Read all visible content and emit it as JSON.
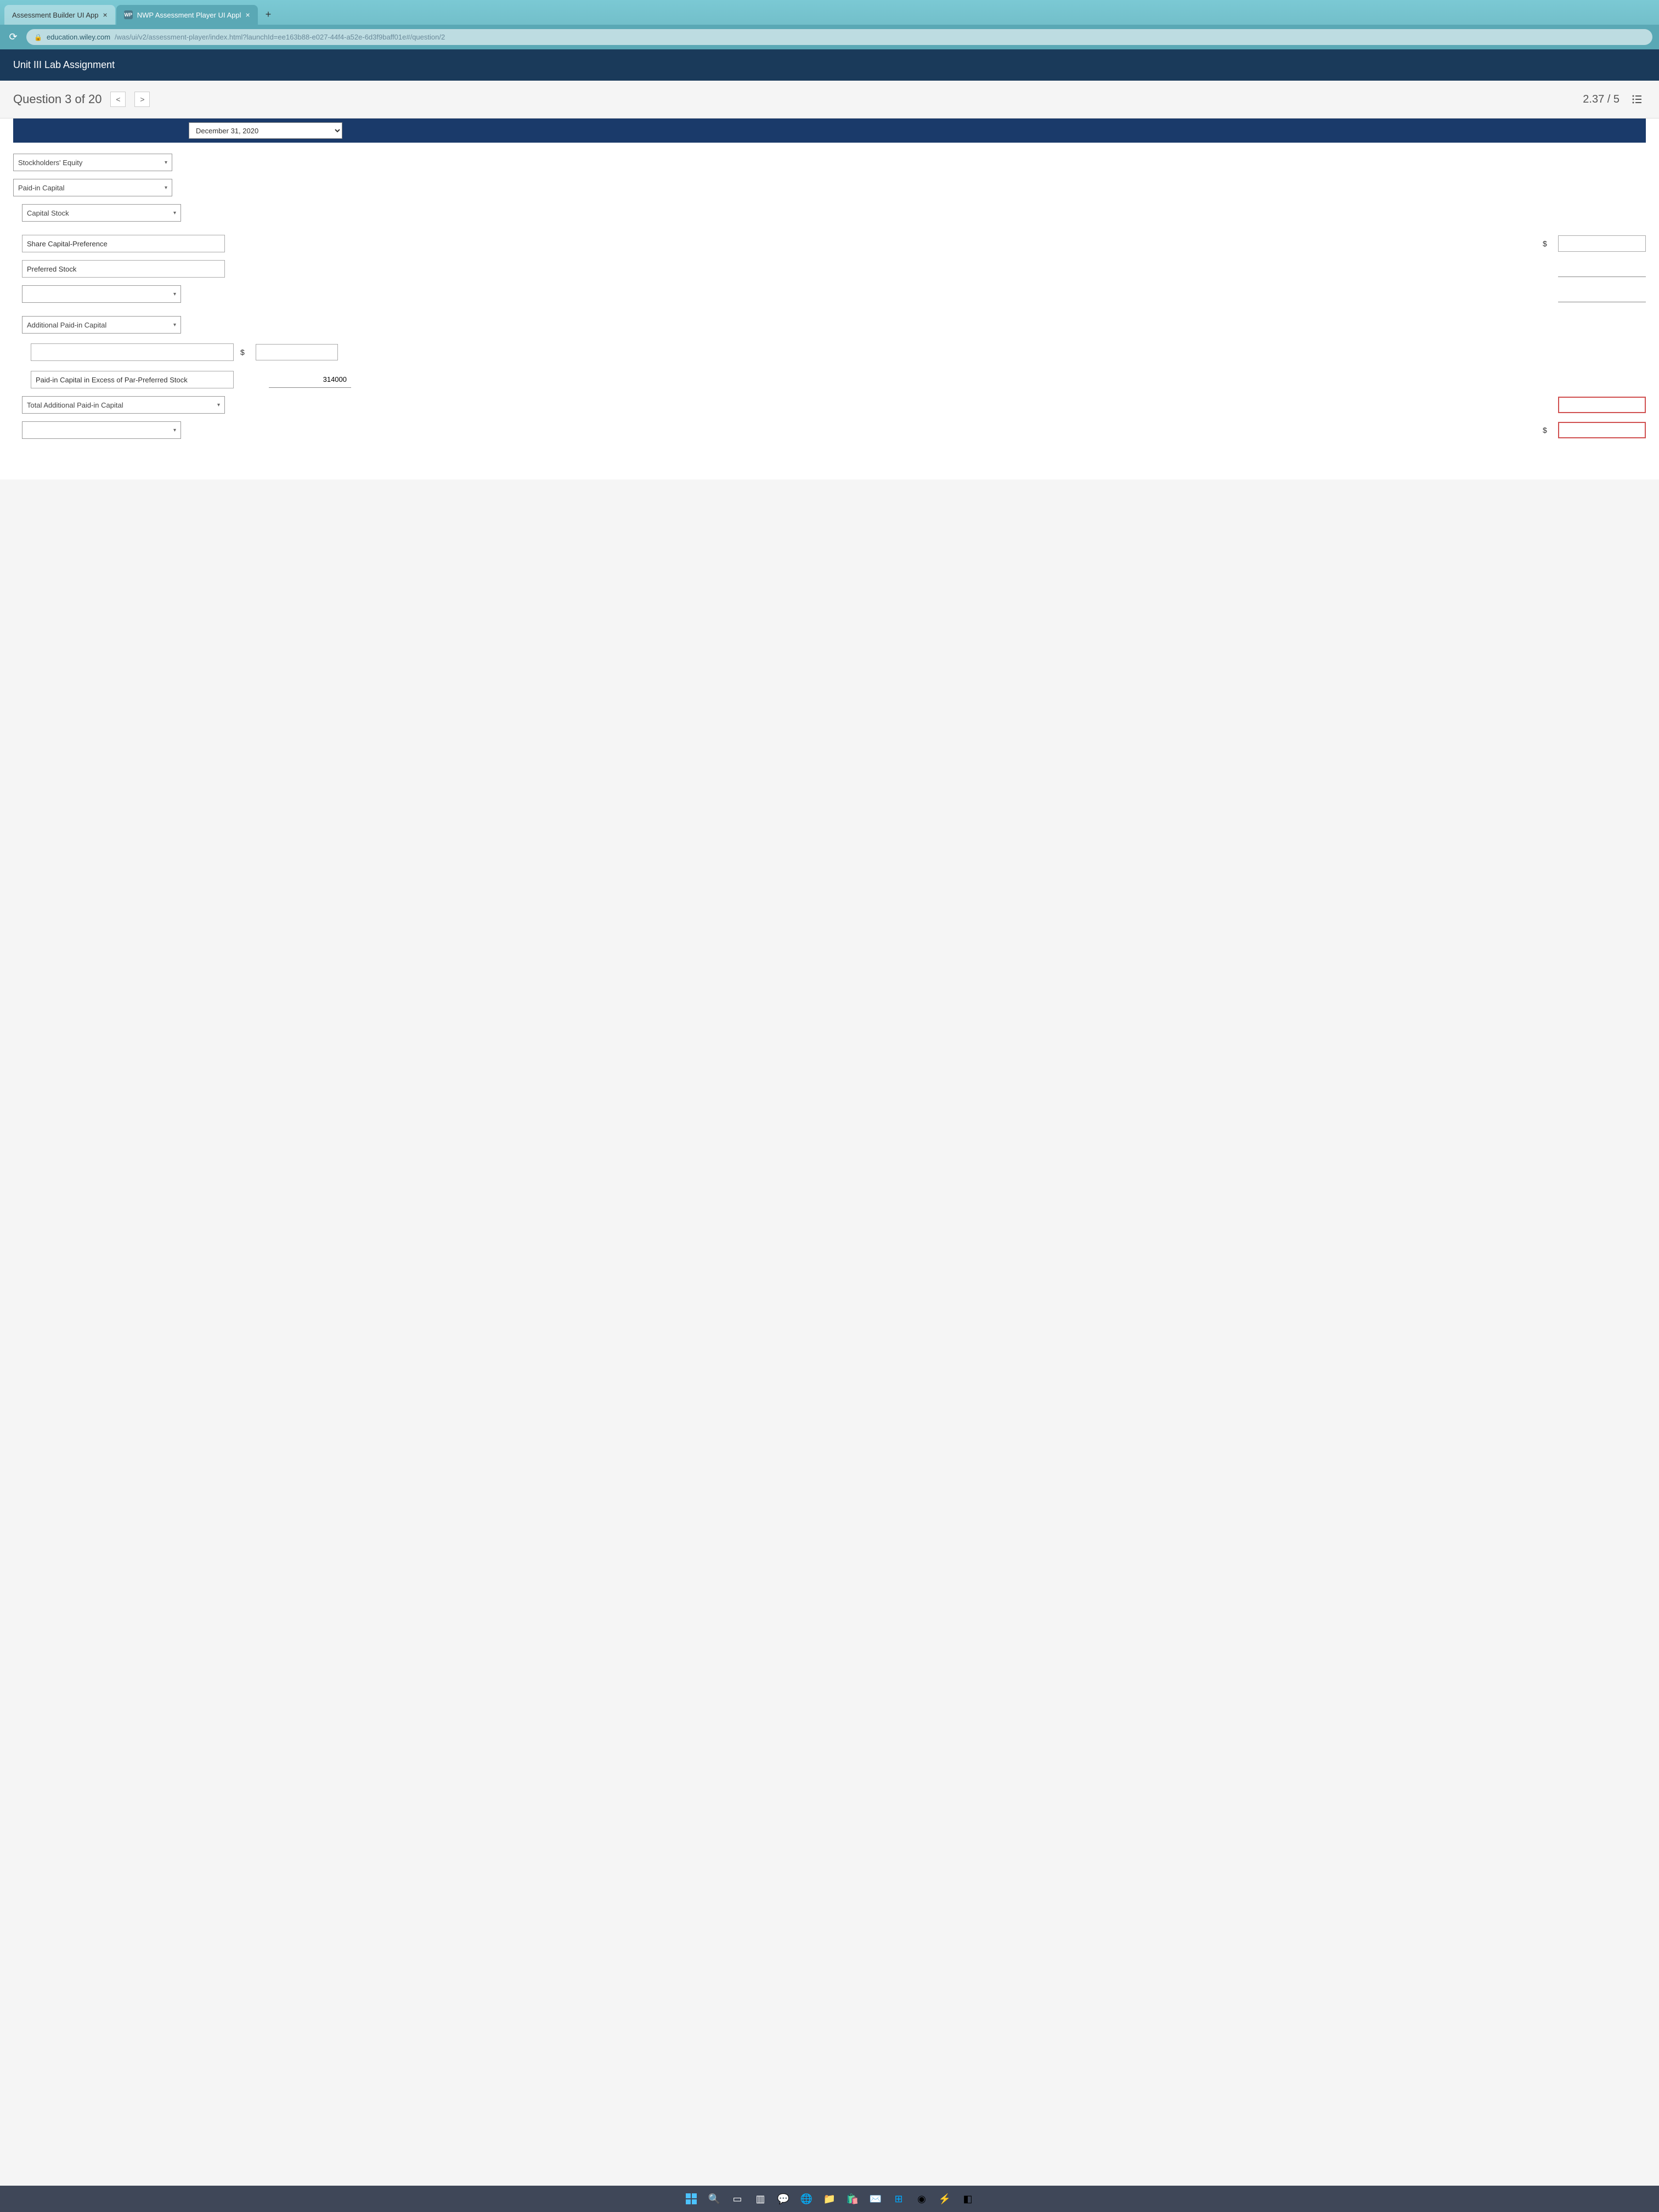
{
  "browser": {
    "tabs": [
      {
        "label": "Assessment Builder UI App",
        "active": false
      },
      {
        "label": "NWP Assessment Player UI Appl",
        "favicon": "WP",
        "active": true
      }
    ],
    "url_domain": "education.wiley.com",
    "url_path": "/was/ui/v2/assessment-player/index.html?launchId=ee163b88-e027-44f4-a52e-6d3f9baff01e#/question/2"
  },
  "app": {
    "title": "Unit III Lab Assignment"
  },
  "question": {
    "label": "Question 3 of 20",
    "score": "2.37 / 5"
  },
  "date_header": "December 31, 2020",
  "fields": {
    "stockholders_equity": "Stockholders' Equity",
    "paid_in_capital": "Paid-in Capital",
    "capital_stock": "Capital Stock",
    "share_capital_preference": "Share Capital-Preference",
    "preferred_stock": "Preferred Stock",
    "additional_paid_in_capital": "Additional Paid-in Capital",
    "paid_in_excess_preferred": "Paid-in Capital in Excess of Par-Preferred Stock",
    "paid_in_excess_value": "314000",
    "total_additional": "Total Additional Paid-in Capital"
  }
}
